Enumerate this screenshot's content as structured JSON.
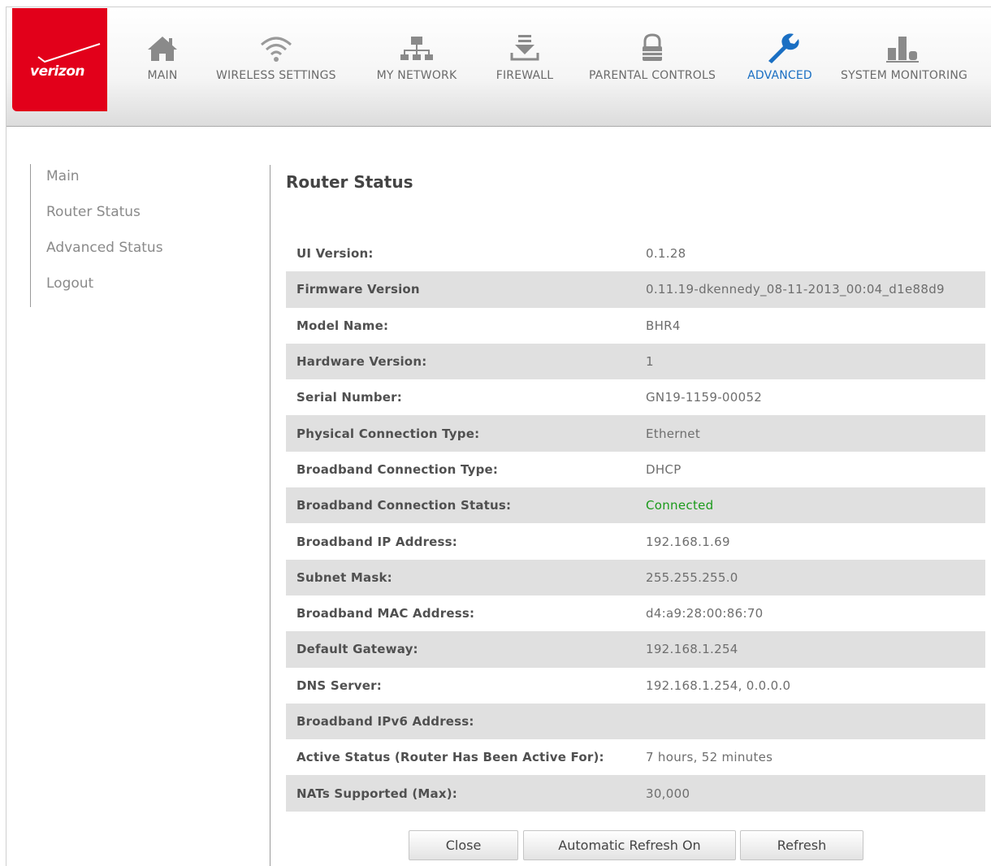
{
  "brand": {
    "logo_text": "verizon",
    "color": "#e2001a"
  },
  "nav": [
    {
      "label": "MAIN",
      "icon": "home-icon"
    },
    {
      "label": "WIRELESS SETTINGS",
      "icon": "wifi-icon"
    },
    {
      "label": "MY NETWORK",
      "icon": "network-icon"
    },
    {
      "label": "FIREWALL",
      "icon": "firewall-icon"
    },
    {
      "label": "PARENTAL CONTROLS",
      "icon": "lock-icon"
    },
    {
      "label": "ADVANCED",
      "icon": "wrench-icon",
      "active": true
    },
    {
      "label": "SYSTEM MONITORING",
      "icon": "bar-chart-icon"
    }
  ],
  "sidebar": {
    "items": [
      {
        "label": "Main"
      },
      {
        "label": "Router Status"
      },
      {
        "label": "Advanced Status"
      },
      {
        "label": "Logout"
      }
    ]
  },
  "main": {
    "title": "Router Status",
    "rows": [
      {
        "label": "UI Version:",
        "value": "0.1.28"
      },
      {
        "label": "Firmware Version",
        "value": "0.11.19-dkennedy_08-11-2013_00:04_d1e88d9"
      },
      {
        "label": "Model Name:",
        "value": "BHR4"
      },
      {
        "label": "Hardware Version:",
        "value": "1"
      },
      {
        "label": "Serial Number:",
        "value": "GN19-1159-00052"
      },
      {
        "label": "Physical Connection Type:",
        "value": "Ethernet"
      },
      {
        "label": "Broadband Connection Type:",
        "value": "DHCP"
      },
      {
        "label": "Broadband Connection Status:",
        "value": "Connected",
        "status_color": "#1a9a1a"
      },
      {
        "label": "Broadband IP Address:",
        "value": "192.168.1.69"
      },
      {
        "label": "Subnet Mask:",
        "value": "255.255.255.0"
      },
      {
        "label": "Broadband MAC Address:",
        "value": "d4:a9:28:00:86:70"
      },
      {
        "label": "Default Gateway:",
        "value": "192.168.1.254"
      },
      {
        "label": "DNS Server:",
        "value": "192.168.1.254, 0.0.0.0"
      },
      {
        "label": "Broadband IPv6 Address:",
        "value": ""
      },
      {
        "label": "Active Status (Router Has Been Active For):",
        "value": "7 hours, 52 minutes"
      },
      {
        "label": "NATs Supported (Max):",
        "value": "30,000"
      }
    ],
    "buttons": {
      "close": "Close",
      "auto_refresh": "Automatic Refresh On",
      "refresh": "Refresh"
    }
  }
}
